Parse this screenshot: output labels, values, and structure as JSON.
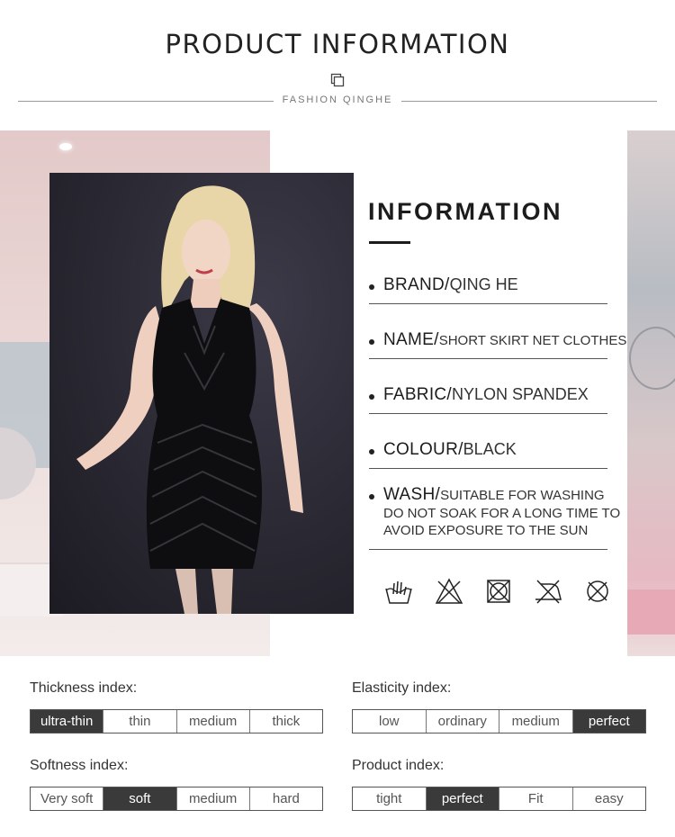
{
  "header": {
    "title": "PRODUCT INFORMATION",
    "subtitle": "FASHION QINGHE"
  },
  "info": {
    "title": "INFORMATION",
    "rows": [
      {
        "key": "BRAND/",
        "value": "QING HE"
      },
      {
        "key": "NAME/",
        "value": "SHORT SKIRT NET CLOTHES"
      },
      {
        "key": "FABRIC/",
        "value": "NYLON SPANDEX"
      },
      {
        "key": "COLOUR/",
        "value": "BLACK"
      },
      {
        "key": "WASH/",
        "value": "SUITABLE FOR WASHING",
        "extra": [
          "DO NOT SOAK FOR A LONG TIME TO",
          "AVOID EXPOSURE TO THE SUN"
        ]
      }
    ],
    "care_icons": [
      "hand-wash-icon",
      "do-not-bleach-icon",
      "do-not-tumble-dry-icon",
      "do-not-iron-icon",
      "do-not-dry-clean-icon"
    ]
  },
  "indices": [
    {
      "label": "Thickness index:",
      "options": [
        "ultra-thin",
        "thin",
        "medium",
        "thick"
      ],
      "selected": 0
    },
    {
      "label": "Elasticity index:",
      "options": [
        "low",
        "ordinary",
        "medium",
        "perfect"
      ],
      "selected": 3
    },
    {
      "label": "Softness index:",
      "options": [
        "Very soft",
        "soft",
        "medium",
        "hard"
      ],
      "selected": 1
    },
    {
      "label": "Product index:",
      "options": [
        "tight",
        "perfect",
        "Fit",
        "easy"
      ],
      "selected": 1
    }
  ],
  "colors": {
    "selected_bg": "#3a3a3a",
    "text": "#1c1c1c"
  }
}
